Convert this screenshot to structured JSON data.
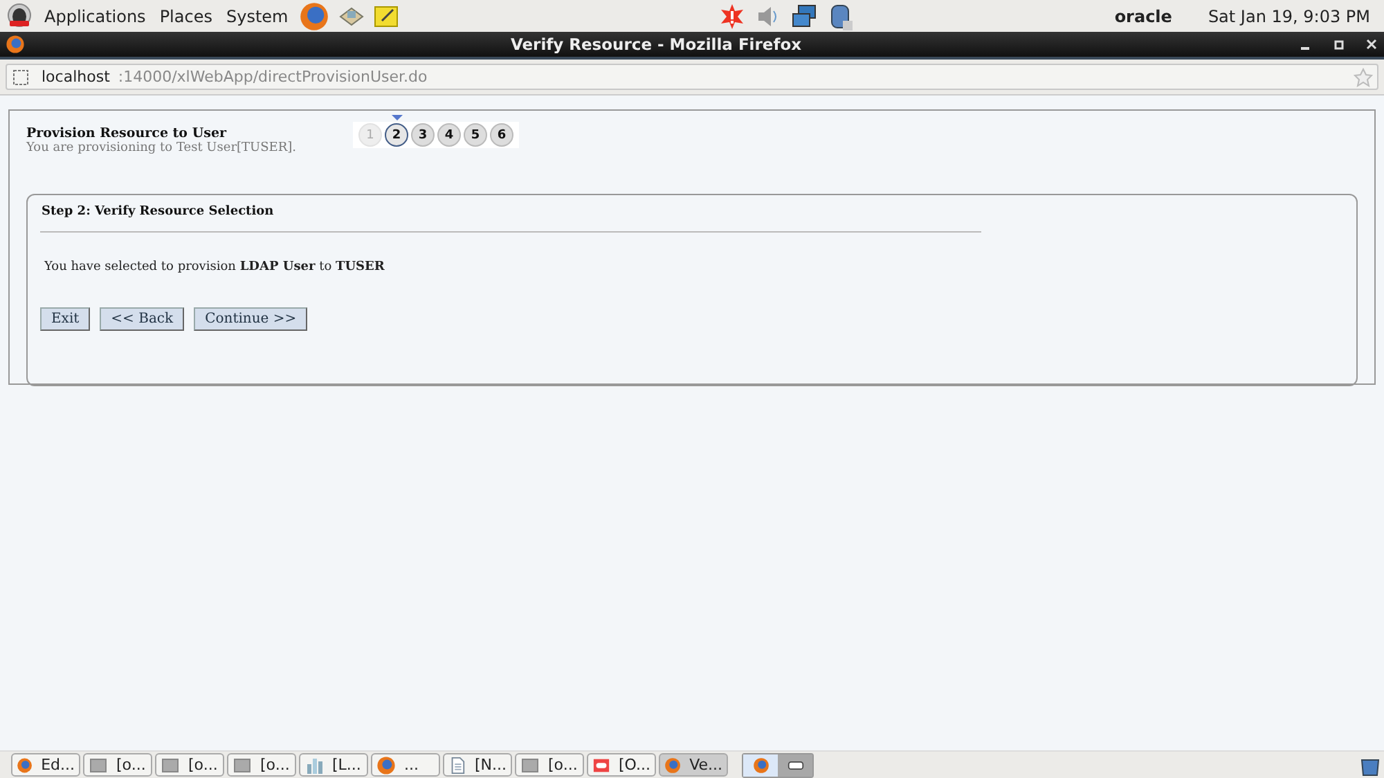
{
  "top_panel": {
    "menus": [
      "Applications",
      "Places",
      "System"
    ],
    "user": "oracle",
    "clock": "Sat Jan 19,  9:03 PM"
  },
  "window": {
    "title": "Verify Resource - Mozilla Firefox"
  },
  "address_bar": {
    "host": "localhost",
    "path": ":14000/xlWebApp/directProvisionUser.do"
  },
  "page": {
    "title": "Provision Resource to User",
    "subtitle": "You are provisioning to Test User[TUSER].",
    "steps": [
      {
        "label": "1",
        "selected": false,
        "disabled": true
      },
      {
        "label": "2",
        "selected": true,
        "disabled": false
      },
      {
        "label": "3",
        "selected": false,
        "disabled": false
      },
      {
        "label": "4",
        "selected": false,
        "disabled": false
      },
      {
        "label": "5",
        "selected": false,
        "disabled": false
      },
      {
        "label": "6",
        "selected": false,
        "disabled": false
      }
    ],
    "section_title": "Step 2: Verify Resource Selection",
    "message": "You have selected to provision **LDAP User** to **TUSER**",
    "buttons": [
      "Exit",
      "<< Back",
      "Continue >>"
    ]
  },
  "taskbar": {
    "items": [
      {
        "kind": "browser",
        "label": "Ed...",
        "selected": false
      },
      {
        "kind": "terminal",
        "label": "[o...",
        "selected": false
      },
      {
        "kind": "terminal",
        "label": "[o...",
        "selected": false
      },
      {
        "kind": "terminal",
        "label": "[o...",
        "selected": false
      },
      {
        "kind": "chart",
        "label": "[L...",
        "selected": false
      },
      {
        "kind": "browser",
        "label": "...",
        "selected": false
      },
      {
        "kind": "document",
        "label": "[N...",
        "selected": false
      },
      {
        "kind": "terminal",
        "label": "[o...",
        "selected": false
      },
      {
        "kind": "oracle",
        "label": "[O...",
        "selected": false
      },
      {
        "kind": "browser",
        "label": "Ve...",
        "selected": true
      }
    ],
    "workspaces": [
      {
        "kind": "browser",
        "selected": true
      },
      {
        "kind": "window",
        "selected": false
      }
    ]
  }
}
